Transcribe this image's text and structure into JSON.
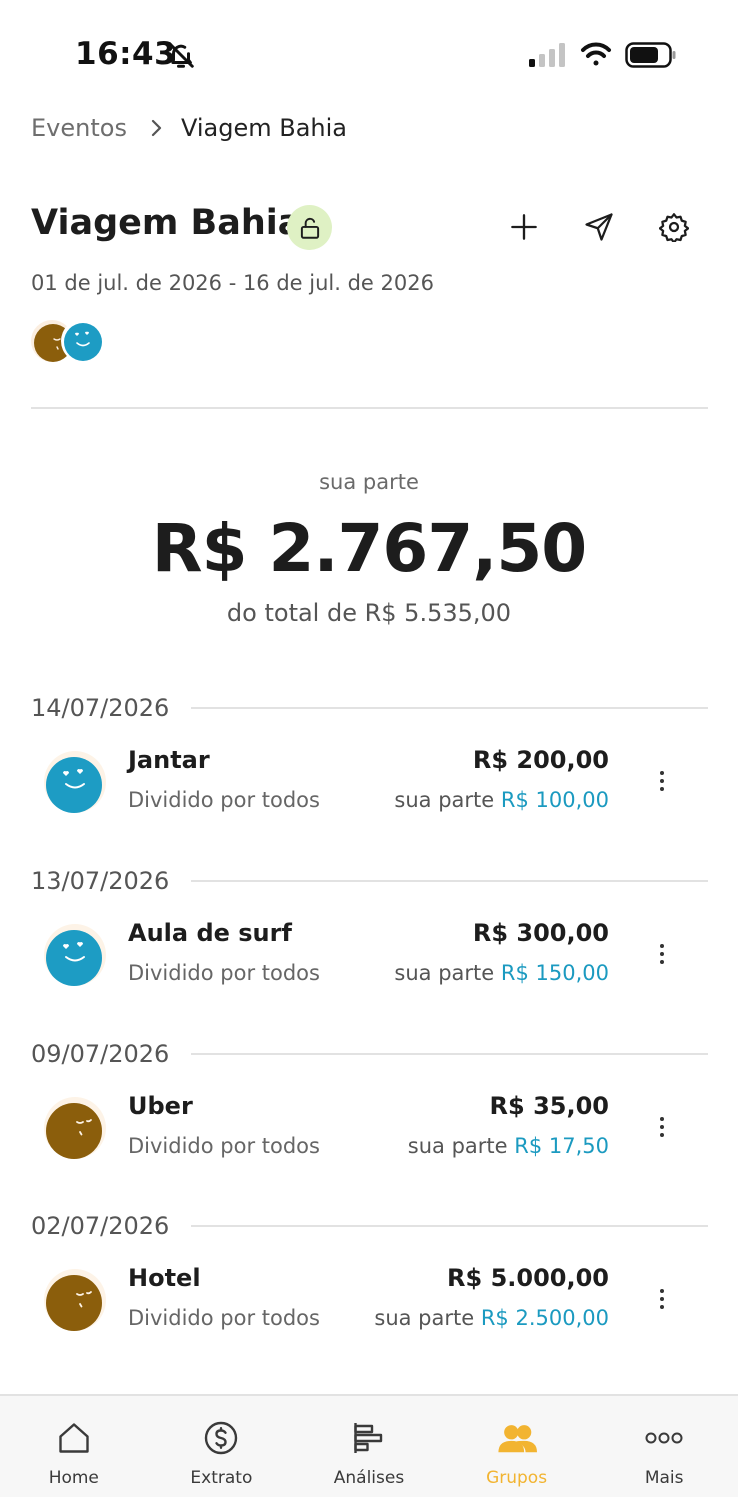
{
  "status_bar": {
    "time": "16:43",
    "icons": [
      "bell-off-icon",
      "signal-icon",
      "wifi-icon",
      "battery-icon"
    ]
  },
  "breadcrumb": {
    "parent": "Eventos",
    "current": "Viagem Bahia"
  },
  "event": {
    "title": "Viagem Bahia",
    "status_icon": "lock-open-icon",
    "dates": "01 de jul. de 2026 - 16 de jul. de 2026",
    "actions": [
      "plus-icon",
      "send-icon",
      "gear-icon"
    ],
    "participants": [
      {
        "avatar": "brown-face-avatar",
        "color": "#8b5e0c"
      },
      {
        "avatar": "blue-face-avatar",
        "color": "#1d9cc4"
      }
    ]
  },
  "summary": {
    "label": "sua parte",
    "amount": "R$ 2.767,50",
    "total_label": "do total de R$ 5.535,00"
  },
  "expenses": [
    {
      "date": "14/07/2026",
      "name": "Jantar",
      "split": "Dividido por todos",
      "amount": "R$ 200,00",
      "share_prefix": "sua parte",
      "share_value": "R$ 100,00",
      "avatar": "blue-face-avatar"
    },
    {
      "date": "13/07/2026",
      "name": "Aula de surf",
      "split": "Dividido por todos",
      "amount": "R$ 300,00",
      "share_prefix": "sua parte",
      "share_value": "R$ 150,00",
      "avatar": "blue-face-avatar"
    },
    {
      "date": "09/07/2026",
      "name": "Uber",
      "split": "Dividido por todos",
      "amount": "R$ 35,00",
      "share_prefix": "sua parte",
      "share_value": "R$ 17,50",
      "avatar": "brown-face-avatar"
    },
    {
      "date": "02/07/2026",
      "name": "Hotel",
      "split": "Dividido por todos",
      "amount": "R$ 5.000,00",
      "share_prefix": "sua parte",
      "share_value": "R$ 2.500,00",
      "avatar": "brown-face-avatar"
    }
  ],
  "bottom_nav": [
    {
      "label": "Home",
      "icon": "home-icon",
      "active": false
    },
    {
      "label": "Extrato",
      "icon": "dollar-circle-icon",
      "active": false
    },
    {
      "label": "Análises",
      "icon": "bar-chart-icon",
      "active": false
    },
    {
      "label": "Grupos",
      "icon": "group-icon",
      "active": true
    },
    {
      "label": "Mais",
      "icon": "more-horizontal-icon",
      "active": false
    }
  ],
  "colors": {
    "accent": "#f2b431",
    "share_value": "#1b9ac0",
    "lock_badge_bg": "#dff1c4",
    "brown_avatar": "#8b5e0c",
    "blue_avatar": "#1d9cc4"
  }
}
